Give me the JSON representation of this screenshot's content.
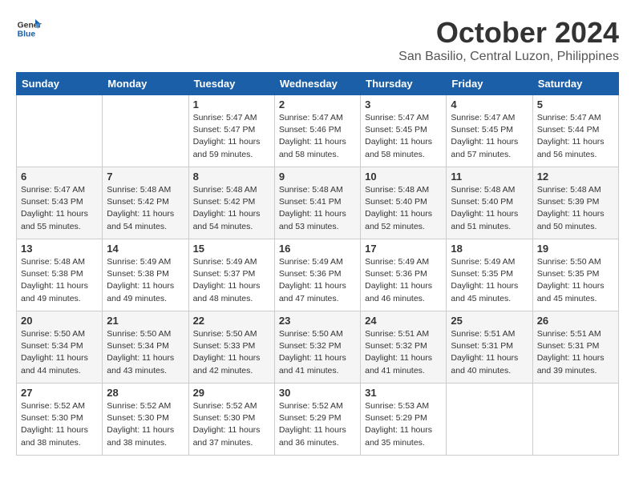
{
  "logo": {
    "line1": "General",
    "line2": "Blue"
  },
  "title": "October 2024",
  "location": "San Basilio, Central Luzon, Philippines",
  "days_header": [
    "Sunday",
    "Monday",
    "Tuesday",
    "Wednesday",
    "Thursday",
    "Friday",
    "Saturday"
  ],
  "weeks": [
    [
      {
        "day": "",
        "info": ""
      },
      {
        "day": "",
        "info": ""
      },
      {
        "day": "1",
        "info": "Sunrise: 5:47 AM\nSunset: 5:47 PM\nDaylight: 11 hours and 59 minutes."
      },
      {
        "day": "2",
        "info": "Sunrise: 5:47 AM\nSunset: 5:46 PM\nDaylight: 11 hours and 58 minutes."
      },
      {
        "day": "3",
        "info": "Sunrise: 5:47 AM\nSunset: 5:45 PM\nDaylight: 11 hours and 58 minutes."
      },
      {
        "day": "4",
        "info": "Sunrise: 5:47 AM\nSunset: 5:45 PM\nDaylight: 11 hours and 57 minutes."
      },
      {
        "day": "5",
        "info": "Sunrise: 5:47 AM\nSunset: 5:44 PM\nDaylight: 11 hours and 56 minutes."
      }
    ],
    [
      {
        "day": "6",
        "info": "Sunrise: 5:47 AM\nSunset: 5:43 PM\nDaylight: 11 hours and 55 minutes."
      },
      {
        "day": "7",
        "info": "Sunrise: 5:48 AM\nSunset: 5:42 PM\nDaylight: 11 hours and 54 minutes."
      },
      {
        "day": "8",
        "info": "Sunrise: 5:48 AM\nSunset: 5:42 PM\nDaylight: 11 hours and 54 minutes."
      },
      {
        "day": "9",
        "info": "Sunrise: 5:48 AM\nSunset: 5:41 PM\nDaylight: 11 hours and 53 minutes."
      },
      {
        "day": "10",
        "info": "Sunrise: 5:48 AM\nSunset: 5:40 PM\nDaylight: 11 hours and 52 minutes."
      },
      {
        "day": "11",
        "info": "Sunrise: 5:48 AM\nSunset: 5:40 PM\nDaylight: 11 hours and 51 minutes."
      },
      {
        "day": "12",
        "info": "Sunrise: 5:48 AM\nSunset: 5:39 PM\nDaylight: 11 hours and 50 minutes."
      }
    ],
    [
      {
        "day": "13",
        "info": "Sunrise: 5:48 AM\nSunset: 5:38 PM\nDaylight: 11 hours and 49 minutes."
      },
      {
        "day": "14",
        "info": "Sunrise: 5:49 AM\nSunset: 5:38 PM\nDaylight: 11 hours and 49 minutes."
      },
      {
        "day": "15",
        "info": "Sunrise: 5:49 AM\nSunset: 5:37 PM\nDaylight: 11 hours and 48 minutes."
      },
      {
        "day": "16",
        "info": "Sunrise: 5:49 AM\nSunset: 5:36 PM\nDaylight: 11 hours and 47 minutes."
      },
      {
        "day": "17",
        "info": "Sunrise: 5:49 AM\nSunset: 5:36 PM\nDaylight: 11 hours and 46 minutes."
      },
      {
        "day": "18",
        "info": "Sunrise: 5:49 AM\nSunset: 5:35 PM\nDaylight: 11 hours and 45 minutes."
      },
      {
        "day": "19",
        "info": "Sunrise: 5:50 AM\nSunset: 5:35 PM\nDaylight: 11 hours and 45 minutes."
      }
    ],
    [
      {
        "day": "20",
        "info": "Sunrise: 5:50 AM\nSunset: 5:34 PM\nDaylight: 11 hours and 44 minutes."
      },
      {
        "day": "21",
        "info": "Sunrise: 5:50 AM\nSunset: 5:34 PM\nDaylight: 11 hours and 43 minutes."
      },
      {
        "day": "22",
        "info": "Sunrise: 5:50 AM\nSunset: 5:33 PM\nDaylight: 11 hours and 42 minutes."
      },
      {
        "day": "23",
        "info": "Sunrise: 5:50 AM\nSunset: 5:32 PM\nDaylight: 11 hours and 41 minutes."
      },
      {
        "day": "24",
        "info": "Sunrise: 5:51 AM\nSunset: 5:32 PM\nDaylight: 11 hours and 41 minutes."
      },
      {
        "day": "25",
        "info": "Sunrise: 5:51 AM\nSunset: 5:31 PM\nDaylight: 11 hours and 40 minutes."
      },
      {
        "day": "26",
        "info": "Sunrise: 5:51 AM\nSunset: 5:31 PM\nDaylight: 11 hours and 39 minutes."
      }
    ],
    [
      {
        "day": "27",
        "info": "Sunrise: 5:52 AM\nSunset: 5:30 PM\nDaylight: 11 hours and 38 minutes."
      },
      {
        "day": "28",
        "info": "Sunrise: 5:52 AM\nSunset: 5:30 PM\nDaylight: 11 hours and 38 minutes."
      },
      {
        "day": "29",
        "info": "Sunrise: 5:52 AM\nSunset: 5:30 PM\nDaylight: 11 hours and 37 minutes."
      },
      {
        "day": "30",
        "info": "Sunrise: 5:52 AM\nSunset: 5:29 PM\nDaylight: 11 hours and 36 minutes."
      },
      {
        "day": "31",
        "info": "Sunrise: 5:53 AM\nSunset: 5:29 PM\nDaylight: 11 hours and 35 minutes."
      },
      {
        "day": "",
        "info": ""
      },
      {
        "day": "",
        "info": ""
      }
    ]
  ]
}
